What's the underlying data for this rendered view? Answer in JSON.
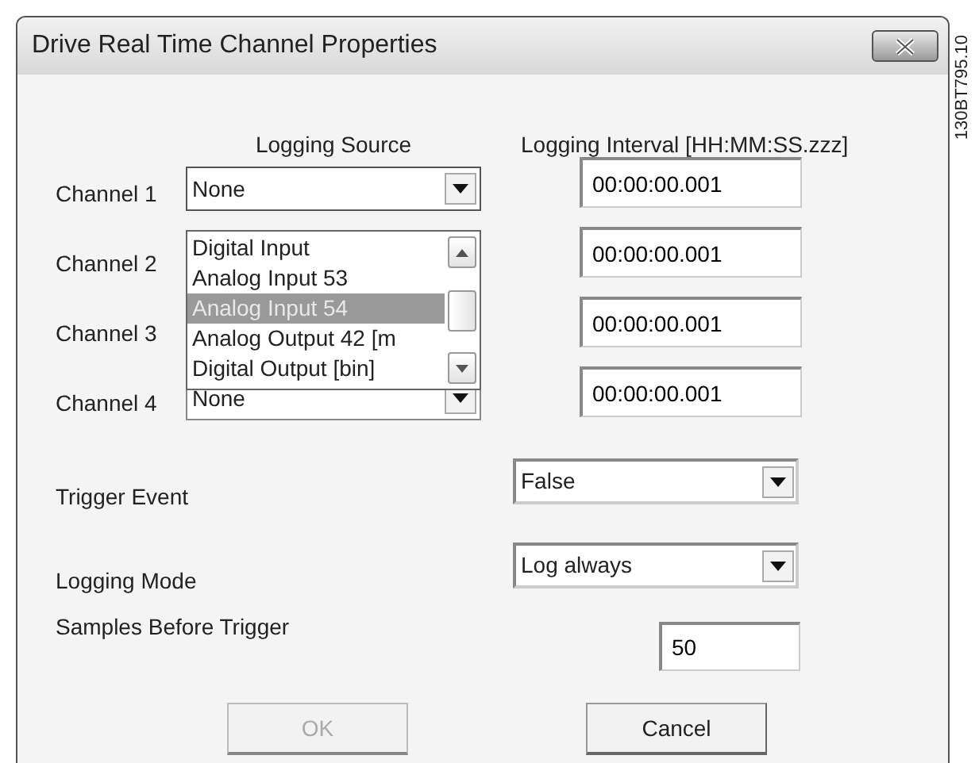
{
  "window": {
    "title": "Drive Real Time Channel Properties"
  },
  "columns": {
    "source": "Logging Source",
    "interval": "Logging Interval [HH:MM:SS.zzz]"
  },
  "channels": [
    {
      "label": "Channel 1",
      "source": "None",
      "open": true,
      "interval": "00:00:00.001"
    },
    {
      "label": "Channel 2",
      "interval": "00:00:00.001"
    },
    {
      "label": "Channel 3",
      "interval": "00:00:00.001"
    },
    {
      "label": "Channel 4",
      "source": "None",
      "open": false,
      "interval": "00:00:00.001"
    }
  ],
  "source_list": [
    {
      "text": "Digital Input",
      "selected": false
    },
    {
      "text": "Analog Input 53",
      "selected": false
    },
    {
      "text": "Analog Input 54",
      "selected": true
    },
    {
      "text": "Analog Output 42 [m",
      "selected": false
    },
    {
      "text": "Digital Output [bin]",
      "selected": false
    }
  ],
  "trigger_event": {
    "label": "Trigger Event",
    "value": "False"
  },
  "logging_mode": {
    "label": "Logging Mode",
    "value": "Log always"
  },
  "samples_before_trigger": {
    "label": "Samples Before Trigger",
    "value": "50"
  },
  "buttons": [
    {
      "label": "OK",
      "disabled": true
    },
    {
      "label": "Cancel",
      "disabled": false
    }
  ],
  "figure_id": "130BT795.10"
}
